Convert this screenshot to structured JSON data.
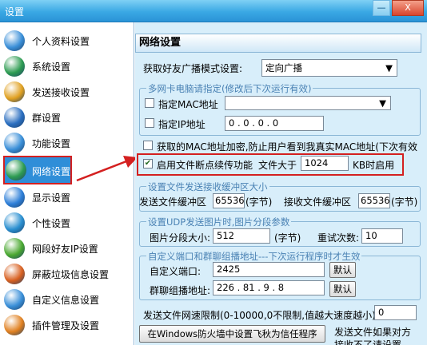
{
  "window": {
    "title": "设置",
    "minimize_label": "—",
    "close_label": "X"
  },
  "sidebar": {
    "items": [
      {
        "label": "个人资料设置",
        "icon": "profile-icon",
        "color": "#3a8fd8"
      },
      {
        "label": "系统设置",
        "icon": "system-icon",
        "color": "#2e9c52"
      },
      {
        "label": "发送接收设置",
        "icon": "send-receive-icon",
        "color": "#e0a020"
      },
      {
        "label": "群设置",
        "icon": "group-icon",
        "color": "#2a6ec0"
      },
      {
        "label": "功能设置",
        "icon": "feature-icon",
        "color": "#3a8fd8"
      },
      {
        "label": "网络设置",
        "icon": "network-icon",
        "color": "#2e9c52",
        "selected": true
      },
      {
        "label": "显示设置",
        "icon": "display-icon",
        "color": "#2e7fd8"
      },
      {
        "label": "个性设置",
        "icon": "personal-icon",
        "color": "#2a8fd0"
      },
      {
        "label": "网段好友IP设置",
        "icon": "ip-icon",
        "color": "#4aa830"
      },
      {
        "label": "屏蔽垃圾信息设置",
        "icon": "block-icon",
        "color": "#d86020"
      },
      {
        "label": "自定义信息设置",
        "icon": "custom-info-icon",
        "color": "#3a8fd8"
      },
      {
        "label": "插件管理及设置",
        "icon": "plugin-icon",
        "color": "#e08020"
      }
    ]
  },
  "main": {
    "header": "网络设置",
    "broadcast_label": "获取好友广播模式设置:",
    "broadcast_value": "定向广播",
    "nic_group_title": "多网卡电脑请指定(修改后下次运行有效)",
    "mac_label": "指定MAC地址",
    "ip_label": "指定IP地址",
    "ip_value": "0 . 0 . 0 . 0",
    "encrypt_mac_label": "获取的MAC地址加密,防止用户看到我真实MAC地址(下次有效",
    "resume_label": "启用文件断点续传功能",
    "file_larger_label": "文件大于",
    "file_larger_value": "1024",
    "kb_label": "KB时启用",
    "buffer_group_title": "设置文件发送接收缓冲区大小",
    "send_buffer_label": "发送文件缓冲区",
    "send_buffer_value": "65536",
    "send_buffer_unit": "(字节)",
    "recv_buffer_label": "接收文件缓冲区",
    "recv_buffer_value": "65536",
    "recv_buffer_unit": "(字节)",
    "udp_group_title": "设置UDP发送图片时,图片分段参数",
    "seg_size_label": "图片分段大小:",
    "seg_size_value": "512",
    "seg_size_unit": "(字节)",
    "retry_label": "重试次数:",
    "retry_value": "10",
    "port_group_title": "自定义端口和群聊组播地址---下次运行程序时才生效",
    "port_label": "自定义端口:",
    "port_value": "2425",
    "default_btn1": "默认",
    "multicast_label": "群聊组播地址:",
    "multicast_value": "226 . 81 . 9 . 8",
    "default_btn2": "默认",
    "speed_label": "发送文件网速限制(0-10000,0不限制,值越大速度越小)",
    "speed_value": "0",
    "firewall_btn": "在Windows防火墙中设置飞秋为信任程序",
    "note_line1": "发送文件如果对方",
    "note_line2": "接收不了请设置"
  },
  "colors": {
    "selected_bg": "#2f8ed8",
    "highlight_red": "#d42020",
    "title_bar": "#3aa8e4",
    "main_bg": "#d8eefa"
  }
}
